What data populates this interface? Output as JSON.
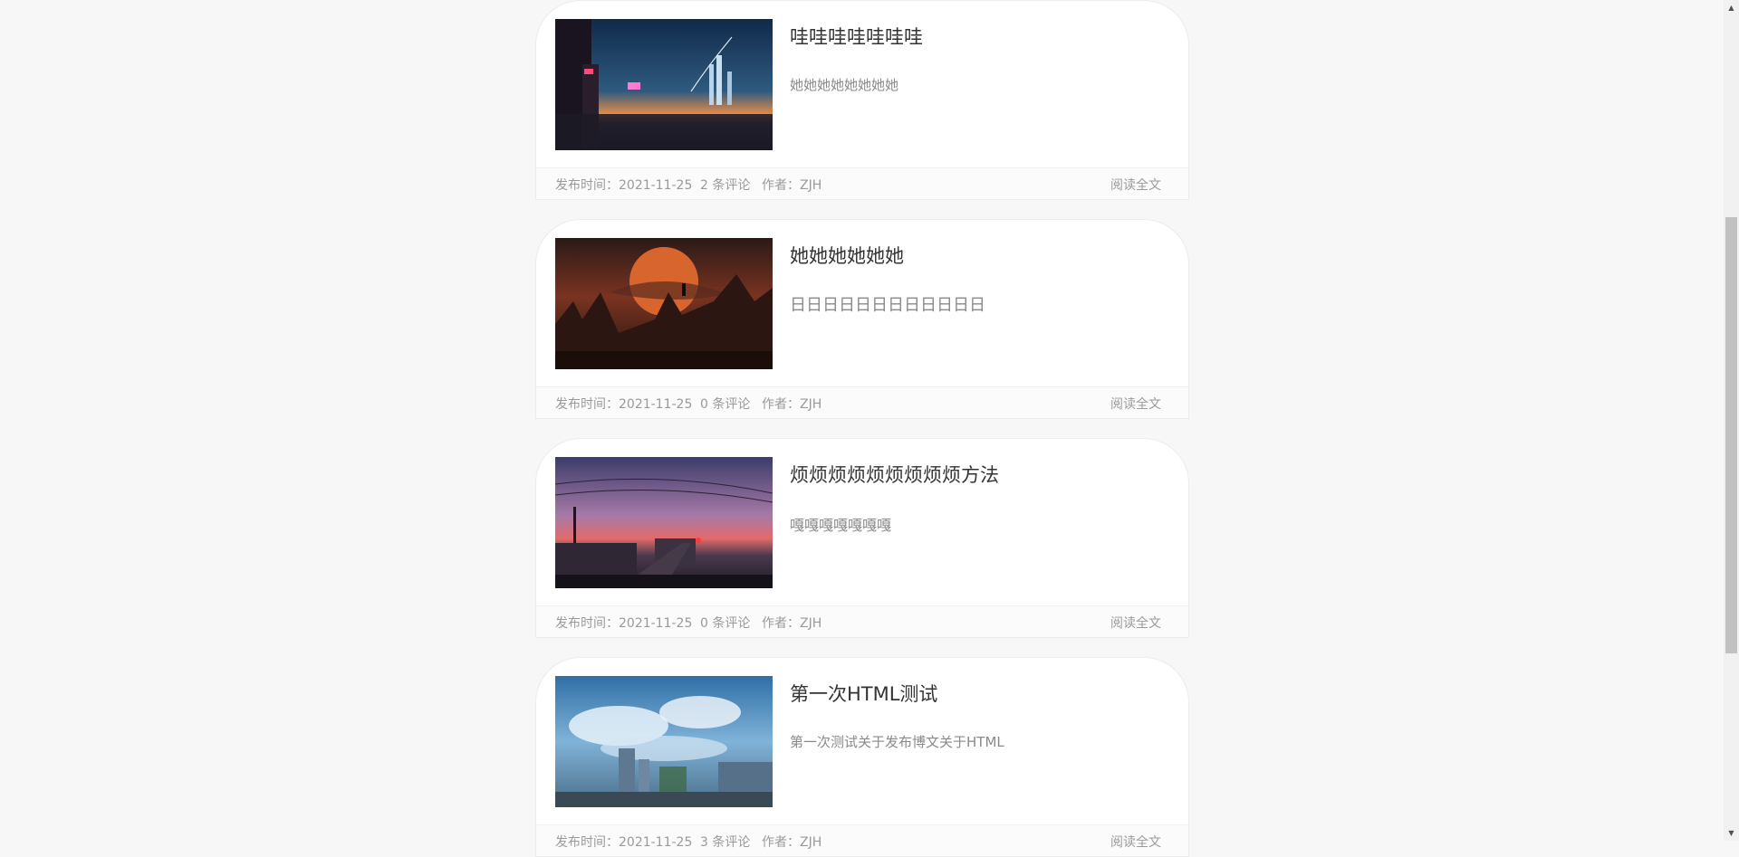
{
  "posts": [
    {
      "title": "哇哇哇哇哇哇哇",
      "excerpt": "她她她她她她她她",
      "date": "发布时间：2021-11-25",
      "comments": "2 条评论",
      "author": "作者：ZJH",
      "read_more": "阅读全文",
      "image_icon": "cyberpunk-city-night-image"
    },
    {
      "title": "她她她她她她",
      "excerpt": "日日日日日日日日日日日日",
      "date": "发布时间：2021-11-25",
      "comments": "0 条评论",
      "author": "作者：ZJH",
      "read_more": "阅读全文",
      "image_icon": "red-moon-landscape-image"
    },
    {
      "title": "烦烦烦烦烦烦烦烦烦方法",
      "excerpt": "嘎嘎嘎嘎嘎嘎嘎",
      "date": "发布时间：2021-11-25",
      "comments": "0 条评论",
      "author": "作者：ZJH",
      "read_more": "阅读全文",
      "image_icon": "sunset-railway-image"
    },
    {
      "title": "第一次HTML测试",
      "excerpt": "第一次测试关于发布博文关于HTML",
      "date": "发布时间：2021-11-25",
      "comments": "3 条评论",
      "author": "作者：ZJH",
      "read_more": "阅读全文",
      "image_icon": "blue-sky-city-image"
    }
  ],
  "colors": {
    "page_bg": "#f7f7f7",
    "card_bg": "#ffffff",
    "title": "#333333",
    "muted": "#9a9a9a"
  }
}
